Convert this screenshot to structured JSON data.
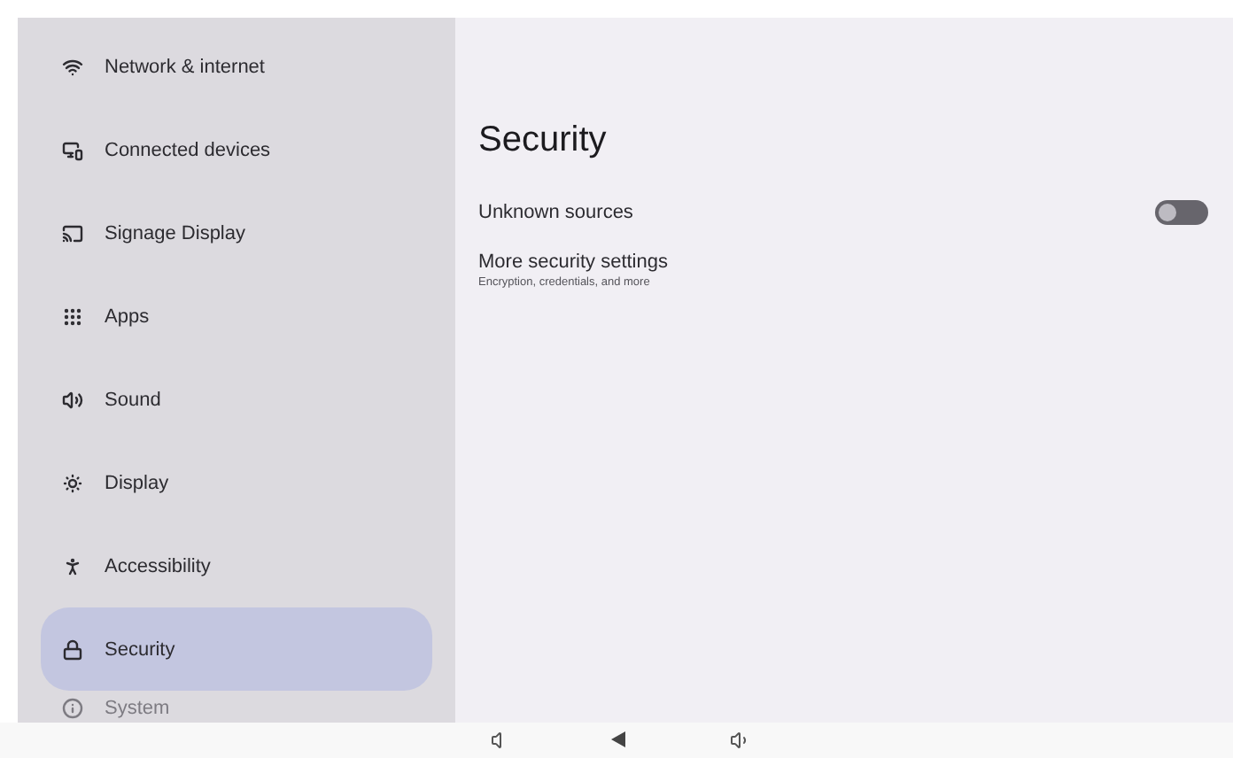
{
  "sidebar": {
    "items": [
      {
        "label": "Network & internet",
        "selected": false
      },
      {
        "label": "Connected devices",
        "selected": false
      },
      {
        "label": "Signage Display",
        "selected": false
      },
      {
        "label": "Apps",
        "selected": false
      },
      {
        "label": "Sound",
        "selected": false
      },
      {
        "label": "Display",
        "selected": false
      },
      {
        "label": "Accessibility",
        "selected": false
      },
      {
        "label": "Security",
        "selected": true
      },
      {
        "label": "System",
        "selected": false
      }
    ]
  },
  "page": {
    "title": "Security",
    "settings": [
      {
        "kind": "toggle",
        "label": "Unknown sources",
        "on": false
      },
      {
        "kind": "link",
        "label": "More security settings",
        "summary": "Encryption, credentials, and more"
      }
    ]
  }
}
